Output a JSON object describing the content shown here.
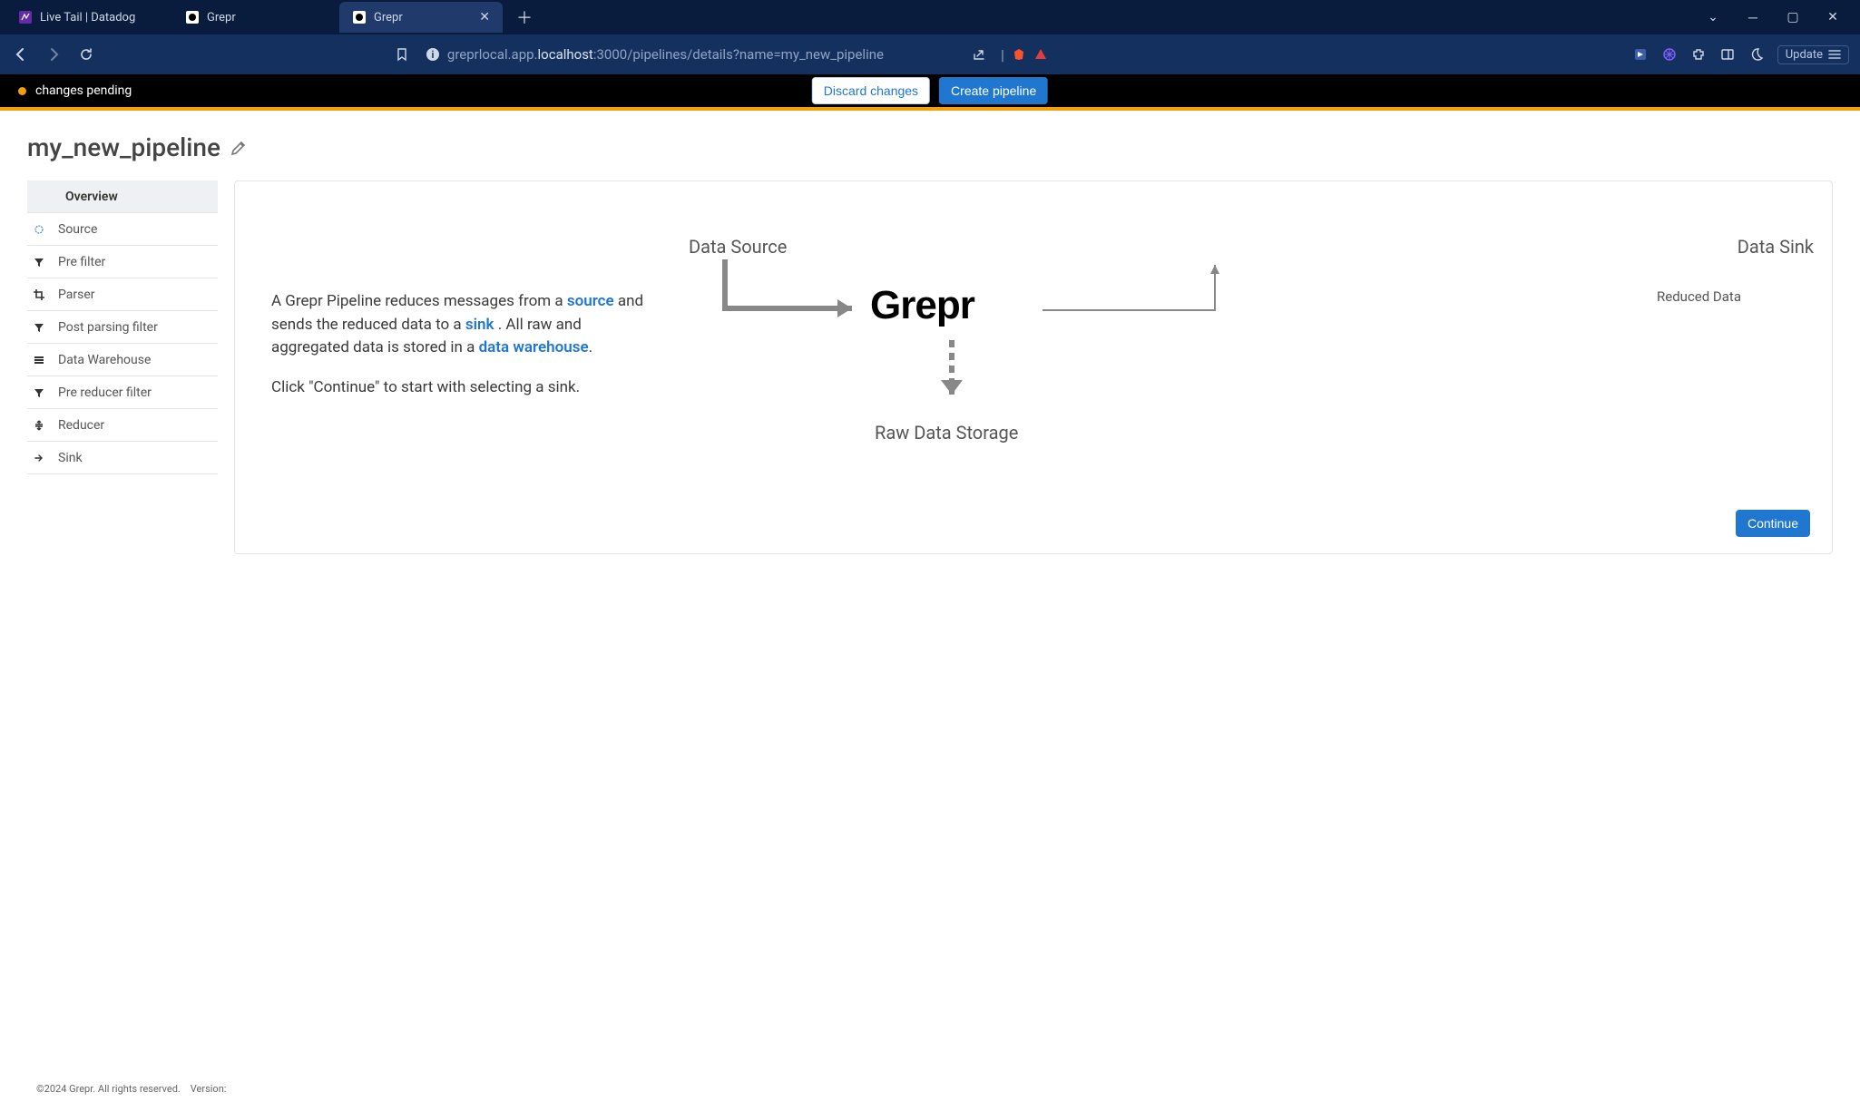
{
  "browser": {
    "tabs": [
      {
        "title": "Live Tail | Datadog",
        "active": false
      },
      {
        "title": "Grepr",
        "active": false
      },
      {
        "title": "Grepr",
        "active": true
      }
    ],
    "url_display": {
      "host_prefix": "greprlocal.app.",
      "host_main": "localhost",
      "port_path": ":3000/pipelines/details?name=my_new_pipeline"
    },
    "update_label": "Update"
  },
  "pending_bar": {
    "text": "changes pending",
    "discard": "Discard changes",
    "create": "Create pipeline"
  },
  "page": {
    "title": "my_new_pipeline",
    "continue": "Continue"
  },
  "sidebar": {
    "items": [
      {
        "label": "Overview",
        "icon": "",
        "active": true
      },
      {
        "label": "Source",
        "icon": "dot"
      },
      {
        "label": "Pre filter",
        "icon": "funnel"
      },
      {
        "label": "Parser",
        "icon": "crop"
      },
      {
        "label": "Post parsing filter",
        "icon": "funnel"
      },
      {
        "label": "Data Warehouse",
        "icon": "db"
      },
      {
        "label": "Pre reducer filter",
        "icon": "funnel"
      },
      {
        "label": "Reducer",
        "icon": "compress"
      },
      {
        "label": "Sink",
        "icon": "arrow-right"
      }
    ]
  },
  "overview": {
    "p1_a": "A Grepr Pipeline reduces messages from a ",
    "source": "source",
    "p1_b": " and sends the reduced data to a ",
    "sink": "sink",
    "p1_c": " . All raw and aggregated data is stored in a ",
    "dw": "data warehouse",
    "p1_d": ".",
    "p2": "Click \"Continue\" to start with selecting a sink."
  },
  "diagram": {
    "data_source": "Data Source",
    "data_sink": "Data Sink",
    "reduced_data": "Reduced Data",
    "raw_storage": "Raw Data Storage",
    "logo": "Grepr"
  },
  "footer": {
    "copyright": "©2024 Grepr. All rights reserved.",
    "version_label": "Version:"
  }
}
